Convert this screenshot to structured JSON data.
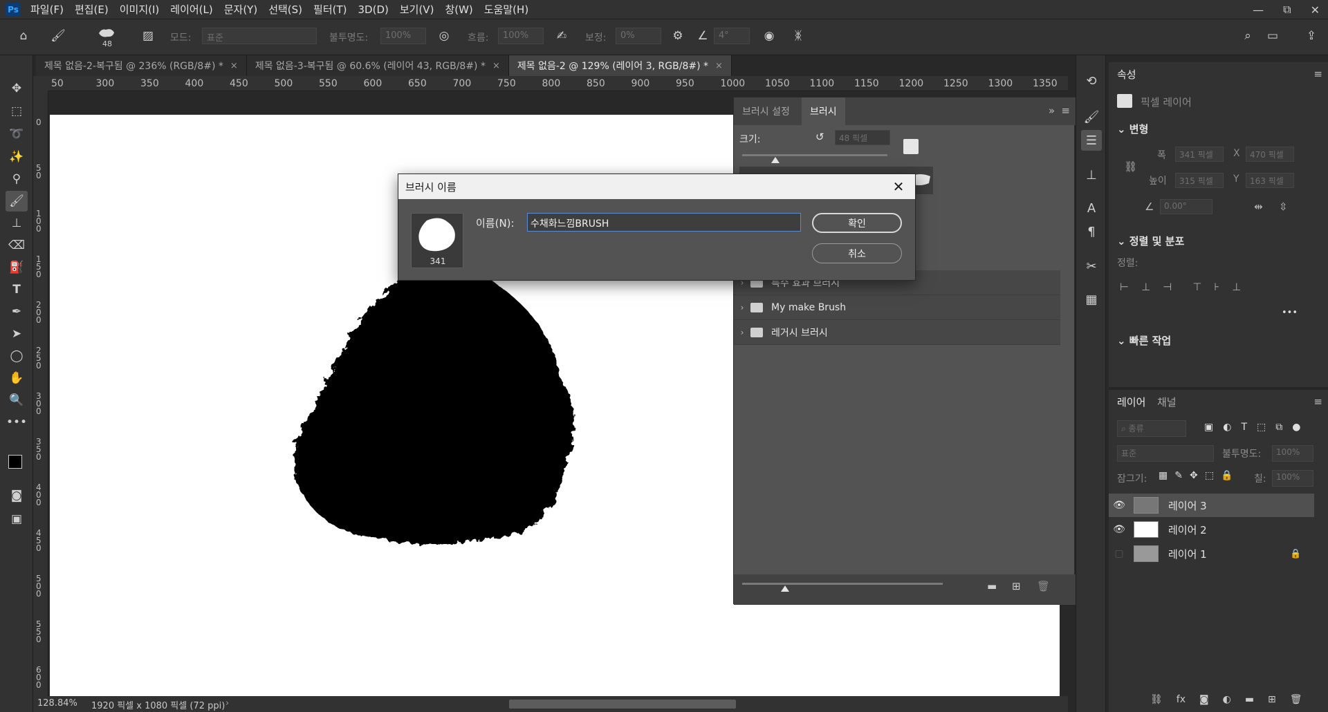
{
  "app": {
    "logo": "Ps"
  },
  "menu": [
    "파일(F)",
    "편집(E)",
    "이미지(I)",
    "레이어(L)",
    "문자(Y)",
    "선택(S)",
    "필터(T)",
    "3D(D)",
    "보기(V)",
    "창(W)",
    "도움말(H)"
  ],
  "window_controls": {
    "minimize": "—",
    "restore": "⧉",
    "close": "✕"
  },
  "options": {
    "brush_size": "48",
    "mode_label": "모드:",
    "mode_value": "표준",
    "opacity_label": "불투명도:",
    "opacity_value": "100%",
    "flow_label": "흐름:",
    "flow_value": "100%",
    "smoothing_label": "보정:",
    "smoothing_value": "0%",
    "angle_value": "4°"
  },
  "tabs": [
    {
      "label": "제목 없음-2-복구됨 @ 236% (RGB/8#) *",
      "close": "×"
    },
    {
      "label": "제목 없음-3-복구됨 @ 60.6% (레이어 43, RGB/8#) *",
      "close": "×"
    },
    {
      "label": "제목 없음-2 @ 129% (레이어 3, RGB/8#) *",
      "close": "×"
    }
  ],
  "ruler": {
    "h_ticks": [
      "50",
      "300",
      "350",
      "400",
      "450",
      "500",
      "550",
      "600",
      "650",
      "700",
      "750",
      "800",
      "850",
      "900",
      "950",
      "1000",
      "1050",
      "1100",
      "1150",
      "1200",
      "1250",
      "1300",
      "1350"
    ],
    "v_ticks": [
      "0",
      "50",
      "100",
      "150",
      "200",
      "250",
      "300",
      "350",
      "400",
      "450",
      "500",
      "550",
      "600"
    ]
  },
  "status": {
    "zoom": "128.84%",
    "doc_info": "1920 픽셀 x 1080 픽셀 (72 ppi)"
  },
  "brush_panel": {
    "tabs": [
      "브러시 설정",
      "브러시"
    ],
    "size_label": "크기:",
    "size_value": "48 픽셀",
    "folders": [
      "특수 효과 브러시",
      "My make Brush",
      "레거시 브러시"
    ]
  },
  "dialog": {
    "title": "브러시 이름",
    "name_label": "이름(N):",
    "name_value": "수채화느낌BRUSH",
    "thumb_size": "341",
    "ok_label": "확인",
    "cancel_label": "취소"
  },
  "properties": {
    "tab": "속성",
    "layer_type": "픽셀 레이어",
    "transform_title": "변형",
    "width_label": "폭",
    "width_value": "341 픽셀",
    "x_label": "X",
    "x_value": "470 픽셀",
    "height_label": "높이",
    "height_value": "315 픽셀",
    "y_label": "Y",
    "y_value": "163 픽셀",
    "angle_value": "0.00°",
    "align_title": "정렬 및 분포",
    "align_label": "정렬:",
    "quick_title": "빠른 작업",
    "more": "•••"
  },
  "layers_panel": {
    "tabs": [
      "레이어",
      "채널"
    ],
    "search_placeholder": "종류",
    "blend_mode": "표준",
    "opacity_label": "불투명도:",
    "opacity_value": "100%",
    "lock_label": "잠그기:",
    "fill_label": "칠:",
    "fill_value": "100%",
    "layers": [
      {
        "name": "레이어 3",
        "visible": true,
        "selected": true
      },
      {
        "name": "레이어 2",
        "visible": true,
        "selected": false
      },
      {
        "name": "레이어 1",
        "visible": false,
        "selected": false
      }
    ]
  },
  "colors": {
    "accent": "#31a8ff",
    "canvas": "#ffffff",
    "foreground": "#000000"
  }
}
